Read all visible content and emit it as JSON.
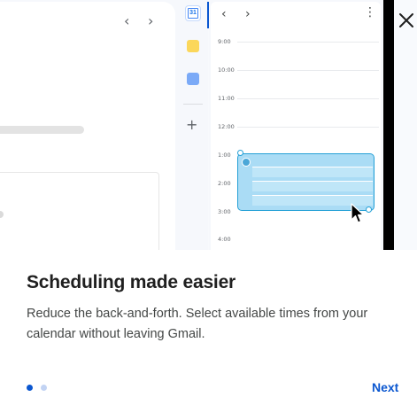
{
  "dialog": {
    "title": "Scheduling made easier",
    "description": "Reduce the back-and-forth. Select available times from your calendar without leaving Gmail.",
    "next_label": "Next",
    "pager": {
      "current": 1,
      "total": 2
    }
  },
  "illustration": {
    "gmail": {
      "prev_glyph": "‹",
      "next_glyph": "›"
    },
    "side_rail": {
      "calendar_day": "31",
      "add_glyph": "+"
    },
    "calendar": {
      "prev_glyph": "‹",
      "next_glyph": "›",
      "more_glyph": "⋮",
      "hours": [
        "9:00",
        "10:00",
        "11:00",
        "12:00",
        "1:00",
        "2:00",
        "3:00",
        "4:00"
      ]
    }
  },
  "colors": {
    "accent": "#0b57d0",
    "event_fill": "#aadcf5",
    "event_border": "#25a0d6",
    "pager_active": "#0b57d0",
    "pager_inactive": "#c4c7c5"
  },
  "icons": [
    "close-icon",
    "chevron-left-icon",
    "chevron-right-icon",
    "more-vert-icon",
    "calendar-icon",
    "keep-icon",
    "tasks-icon",
    "add-icon",
    "cursor-icon"
  ]
}
